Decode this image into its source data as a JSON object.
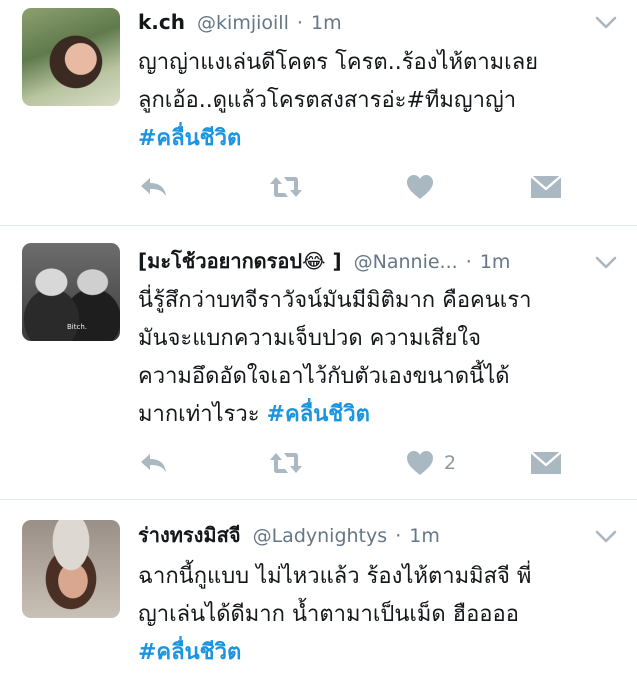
{
  "tweets": [
    {
      "display_name": "k.ch",
      "handle": "@kimjioill",
      "separator": "·",
      "time": "1m",
      "lines": [
        "ญาญ่าแงเล่นดีโคตร โครต..ร้องไห้ตามเลย",
        "ลูกเอ้อ..ดูแล้วโครตสงสารอ่ะ#ทีมญาญ่า"
      ],
      "hashtag": "#คลื่นชีวิต",
      "like_count": ""
    },
    {
      "display_name": "[มะโช้วอยากดรอป😂 ]",
      "handle": "@Nannie...",
      "separator": "·",
      "time": "1m",
      "lines": [
        "นี่รู้สึกว่าบทจีราวัจน์มันมีมิติมาก คือคนเรา",
        "มันจะแบกความเจ็บปวด ความเสียใจ",
        "ความอึดอัดใจเอาไว้กับตัวเองขนาดนี้ได้"
      ],
      "last_line_text": "มากเท่าไรวะ ",
      "hashtag": "#คลื่นชีวิต",
      "like_count": "2"
    },
    {
      "display_name": "ร่างทรงมิสจี",
      "handle": "@Ladynightys",
      "separator": "·",
      "time": "1m",
      "lines": [
        "ฉากนี้กูแบบ ไม่ไหวแล้ว ร้องไห้ตามมิสจี พี่",
        "ญาเล่นได้ดีมาก น้ำตามาเป็นเม็ด ฮืออออ"
      ],
      "hashtag": "#คลื่นชีวิต"
    }
  ],
  "avatar_watermark": "Bitch.",
  "icons": {
    "reply": "reply-icon",
    "retweet": "retweet-icon",
    "like": "heart-icon",
    "dm": "envelope-icon",
    "menu": "chevron-down-icon"
  },
  "colors": {
    "hashtag": "#1b95e0",
    "meta": "#657786",
    "icon": "#aab8c2",
    "text": "#14171a"
  }
}
